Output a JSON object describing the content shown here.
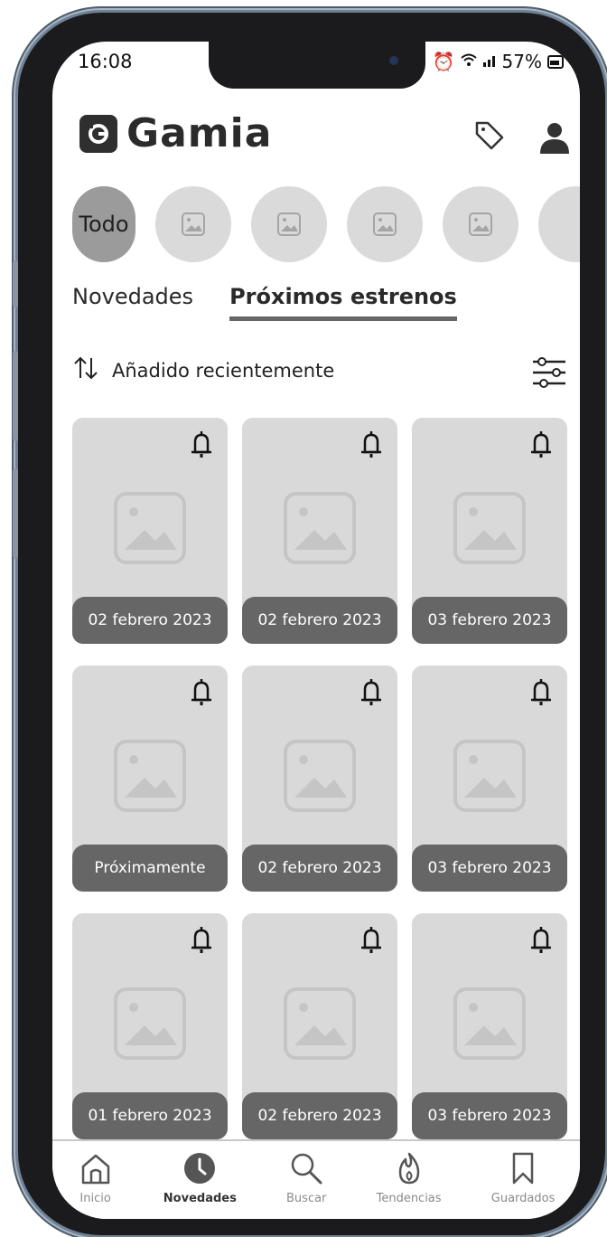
{
  "status": {
    "time": "16:08",
    "battery": "57%"
  },
  "app": {
    "name": "Gamia"
  },
  "chips": {
    "first_label": "Todo"
  },
  "tabs": {
    "news": "Novedades",
    "upcoming": "Próximos estrenos",
    "active": "upcoming"
  },
  "sort": {
    "label": "Añadido recientemente"
  },
  "cards": [
    {
      "date": "02 febrero 2023"
    },
    {
      "date": "02 febrero 2023"
    },
    {
      "date": "03 febrero 2023"
    },
    {
      "date": "Próximamente"
    },
    {
      "date": "02 febrero 2023"
    },
    {
      "date": "03 febrero 2023"
    },
    {
      "date": "01 febrero 2023"
    },
    {
      "date": "02 febrero 2023"
    },
    {
      "date": "03 febrero 2023"
    }
  ],
  "nav": {
    "home": "Inicio",
    "news": "Novedades",
    "search": "Buscar",
    "trends": "Tendencias",
    "saved": "Guardados",
    "active": "news"
  },
  "icons": [
    "tag-icon",
    "user-icon",
    "sort-icon",
    "filter-icon",
    "bell-icon",
    "image-placeholder-icon",
    "home-icon",
    "clock-icon",
    "search-icon",
    "flame-icon",
    "bookmark-icon"
  ]
}
